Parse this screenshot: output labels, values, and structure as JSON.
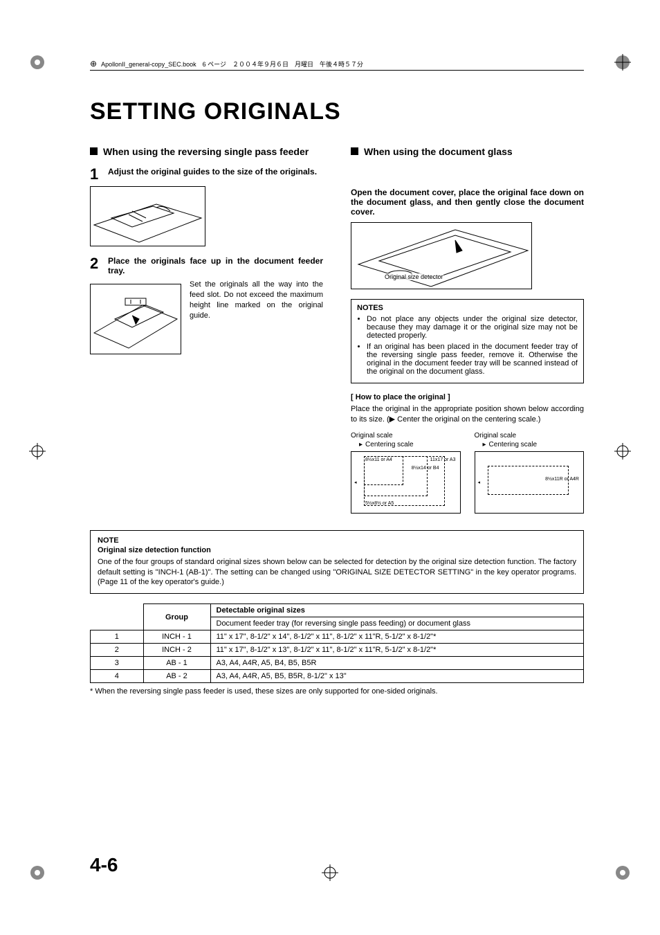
{
  "header": {
    "book_ref": "ApollonII_general-copy_SEC.book　6 ページ　２００４年９月６日　月曜日　午後４時５７分"
  },
  "title": "SETTING ORIGINALS",
  "left": {
    "heading": "When using the reversing single pass feeder",
    "step1_num": "1",
    "step1_text": "Adjust the original guides to the size of the originals.",
    "step2_num": "2",
    "step2_text": "Place the originals face up in the document feeder tray.",
    "step2_side": "Set the originals all the way into the feed slot. Do not exceed the maximum height line marked on the original guide."
  },
  "right": {
    "heading": "When using the document glass",
    "instr": "Open the document cover, place the original face down on the document glass, and then gently close the document cover.",
    "fig_label": "Original size detector",
    "notes_title": "NOTES",
    "note1": "Do not place any objects under the original size detector, because they may damage it or the original size may not be detected properly.",
    "note2": "If an original has been placed in the document feeder tray of the reversing single pass feeder, remove it. Otherwise the original in the document feeder tray will be scanned instead of the original on the document glass.",
    "howto_title": "[ How to place the original ]",
    "howto_body": "Place the original in the appropriate position shown below according to its size. (▶ Center the original on the centering scale.)",
    "scale_label": "Original scale",
    "centering_label": "Centering scale",
    "d1_a": "8½x11 or A4",
    "d1_b": "11x17 or A3",
    "d1_c": "8½x14 or B4",
    "d1_d": "5½x8½ or A5",
    "d2_a": "8½x11R or A4R"
  },
  "note2": {
    "title": "NOTE",
    "subtitle": "Original size detection function",
    "para": "One of the four groups of standard original sizes shown below can be selected for detection by the original size detection function. The factory default setting is \"INCH-1 (AB-1)\". The setting can be changed using \"ORIGINAL SIZE DETECTOR SETTING\" in the key operator programs. (Page 11 of the key operator's guide.)"
  },
  "table": {
    "h_group": "Group",
    "h_sizes": "Detectable original sizes",
    "h_sub": "Document feeder tray (for reversing single pass feeding) or document glass",
    "rows": [
      {
        "n": "1",
        "g": "INCH - 1",
        "s": "11\" x 17\", 8-1/2\" x 14\", 8-1/2\" x 11\", 8-1/2\" x 11\"R, 5-1/2\" x 8-1/2\"*"
      },
      {
        "n": "2",
        "g": "INCH - 2",
        "s": "11\" x 17\", 8-1/2\" x 13\", 8-1/2\" x 11\", 8-1/2\" x 11\"R, 5-1/2\" x 8-1/2\"*"
      },
      {
        "n": "3",
        "g": "AB - 1",
        "s": "A3, A4, A4R, A5, B4, B5, B5R"
      },
      {
        "n": "4",
        "g": "AB - 2",
        "s": "A3, A4, A4R, A5, B5, B5R, 8-1/2\" x 13\""
      }
    ]
  },
  "footnote": "*  When the reversing single pass feeder is used, these sizes are only supported for one-sided originals.",
  "page_num": "4-6"
}
